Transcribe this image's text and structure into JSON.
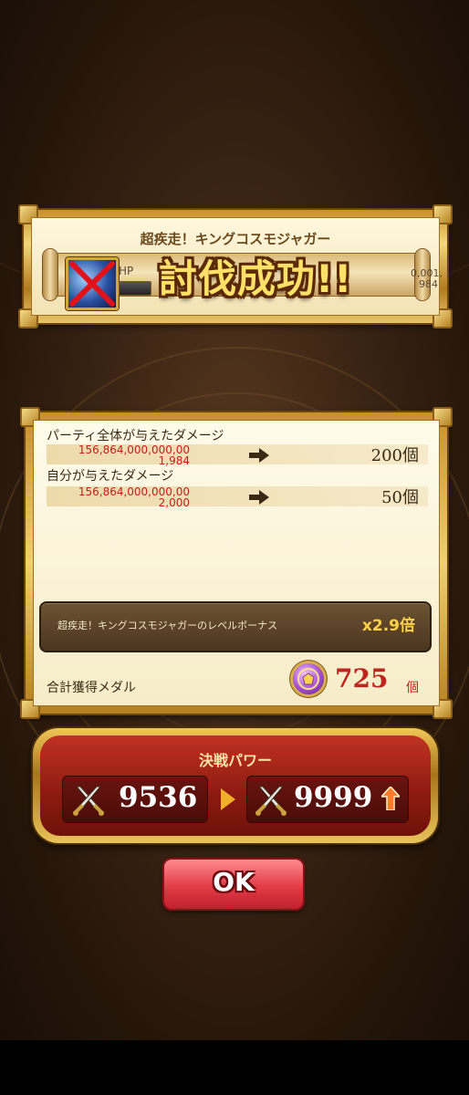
{
  "banner": {
    "boss_name": "超疾走！キングコスモジャガー",
    "hp_label": "HP",
    "hp_value_line1": "0,001,",
    "hp_value_line2": "984",
    "result_text": "討伐成功!!"
  },
  "rewards": {
    "rows": [
      {
        "label": "パーティ全体が与えたダメージ",
        "damage_line1": "156,864,000,000,00",
        "damage_line2": "1,984",
        "count": "200個"
      },
      {
        "label": "自分が与えたダメージ",
        "damage_line1": "156,864,000,000,00",
        "damage_line2": "2,000",
        "count": "50個"
      }
    ],
    "bonus_text": "超疾走！キングコスモジャガーのレベルボーナス",
    "bonus_multiplier": "x2.9倍",
    "total_label": "合計獲得メダル",
    "total_value": "725",
    "total_unit": "個"
  },
  "power": {
    "title": "決戦パワー",
    "before": "9536",
    "after": "9999"
  },
  "ok_button": {
    "label": "OK"
  }
}
